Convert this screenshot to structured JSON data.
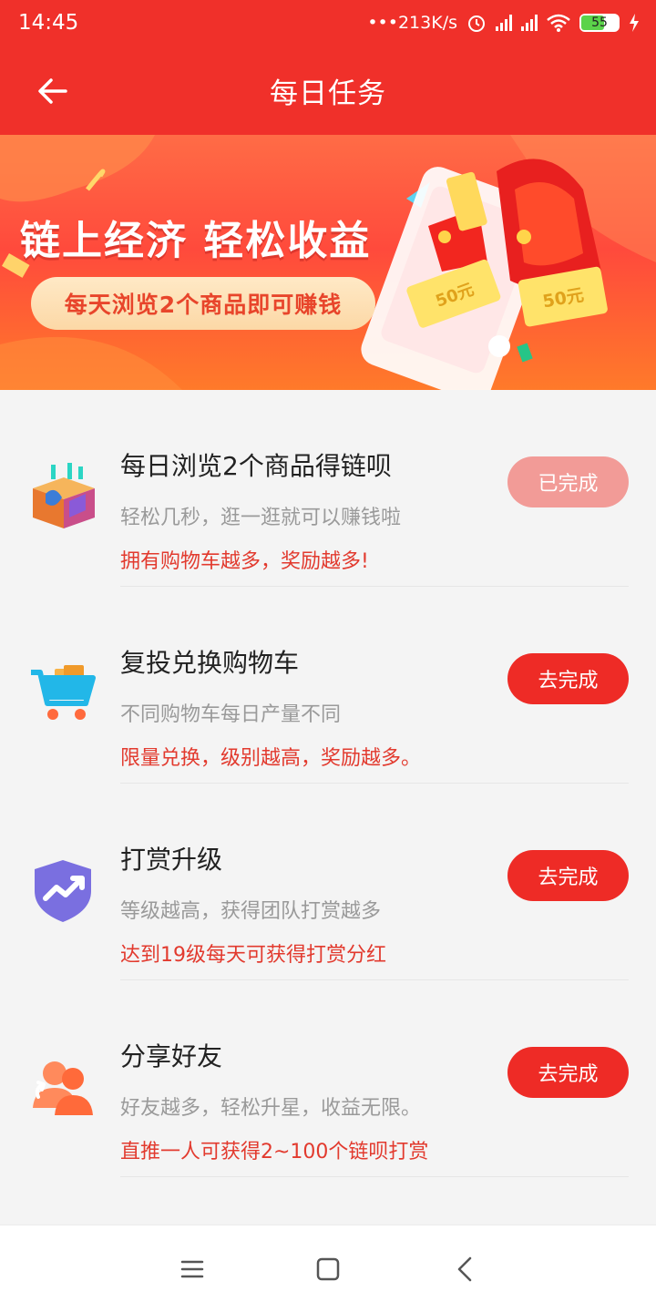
{
  "status_bar": {
    "time": "14:45",
    "network_speed": "213K/s",
    "battery": "55",
    "icons": [
      "alarm-icon",
      "signal-icon",
      "wifi-icon",
      "battery-icon",
      "charging-icon"
    ]
  },
  "app_bar": {
    "title": "每日任务",
    "back_icon": "back-arrow-icon"
  },
  "banner": {
    "headline": "链上经济  轻松收益",
    "pill_text": "每天浏览2个商品即可赚钱",
    "coupon_values": [
      "50元",
      "50元",
      "50元"
    ]
  },
  "tasks": [
    {
      "title": "每日浏览2个商品得链呗",
      "desc": "轻松几秒，逛一逛就可以赚钱啦",
      "reward": "拥有购物车越多，奖励越多!",
      "button": "已完成",
      "status": "completed",
      "icon": "browse-box-icon"
    },
    {
      "title": "复投兑换购物车",
      "desc": "不同购物车每日产量不同",
      "reward": "限量兑换，级别越高，奖励越多。",
      "button": "去完成",
      "status": "pending",
      "icon": "shopping-cart-icon"
    },
    {
      "title": "打赏升级",
      "desc": "等级越高，获得团队打赏越多",
      "reward": "达到19级每天可获得打赏分红",
      "button": "去完成",
      "status": "pending",
      "icon": "shield-upgrade-icon"
    },
    {
      "title": "分享好友",
      "desc": "好友越多，轻松升星，收益无限。",
      "reward": "直推一人可获得2~100个链呗打赏",
      "button": "去完成",
      "status": "pending",
      "icon": "share-friends-icon"
    }
  ],
  "nav_bar": {
    "icons": [
      "menu-icon",
      "home-icon",
      "back-icon"
    ]
  },
  "colors": {
    "primary": "#f0302a",
    "button": "#ee2b26",
    "button_done": "#f29b97",
    "reward_text": "#e23a2e",
    "muted_text": "#9a9a9a"
  }
}
